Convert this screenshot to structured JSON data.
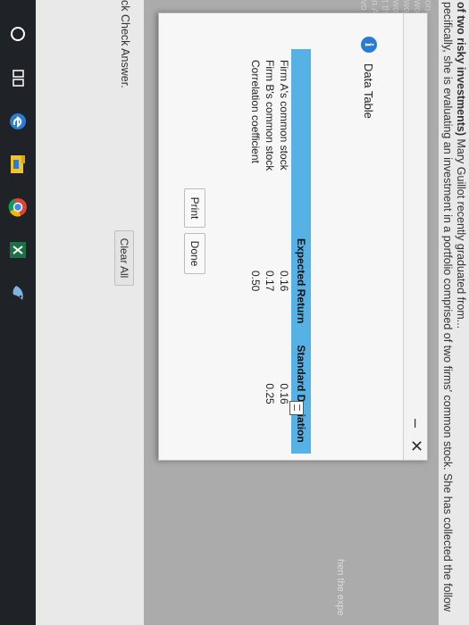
{
  "background": {
    "line1_bold": "of two risky investments)",
    "line1_rest": " Mary Guillot recently graduated from...",
    "line2": "pecifically, she is evaluating an investment in a portfolio comprised of two firms' common stock. She has collected the follow",
    "left_fragments": [
      "on",
      "wo",
      "wo",
      "wo",
      "t th",
      "n A",
      "vo c"
    ],
    "right_fragment": "hen the expe",
    "check_answer": "ck Check Answer.",
    "clear_all": "Clear All"
  },
  "dialog": {
    "title": "Data Table",
    "info_icon": "i",
    "minimize_glyph": "–",
    "close_glyph": "✕",
    "table": {
      "headers": [
        "",
        "Expected Return",
        "Standard Deviation"
      ],
      "rows": [
        [
          "Firm A's common stock",
          "0.16",
          "0.16"
        ],
        [
          "Firm B's common stock",
          "0.17",
          "0.25"
        ],
        [
          "Correlation coefficient",
          "0.50",
          ""
        ]
      ]
    },
    "buttons": {
      "print": "Print",
      "done": "Done"
    }
  },
  "taskbar": {
    "items": [
      "search-circle-icon",
      "task-view-icon",
      "edge-icon",
      "file-explorer-icon",
      "chrome-icon",
      "excel-icon",
      "bird-app-icon"
    ]
  },
  "colors": {
    "header_blue": "#56b2e5",
    "info_blue": "#2a7bd3"
  }
}
